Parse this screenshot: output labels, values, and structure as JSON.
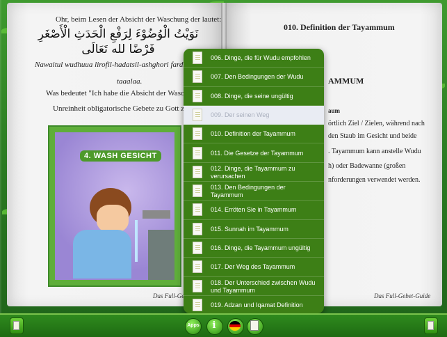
{
  "book": {
    "left": {
      "text1": "Ohr, beim Lesen der Absicht der Waschung der lautet:",
      "arabic": "نَوَيْتُ الْوُضُوْءَ لِرَفْعِ الْحَدَثِ الْأَصْغَرِ فَرْضًا لله تَعَالَى",
      "translit1": "Nawaitul wudhuua lirofil-hadatsil-ashghori fardhal li",
      "translit2": "taaalaa.",
      "text2": "Was bedeutet \"Ich habe die Absicht der Waschung",
      "text3": "Unreinheit obligatorische Gebete zu Gott zu bes",
      "illustration_title": "4. WASH GESICHT",
      "footer": "Das Full-Ge"
    },
    "right": {
      "title": "010. Definition der Tayammum",
      "heading": "AMMUM",
      "sub": "aum",
      "lines": [
        "örtlich Ziel / Zielen, während nach",
        "den Staub im Gesicht und beide",
        ".  Tayammum kann anstelle Wudu",
        "h)     oder     Badewanne     (großen",
        "nforderungen verwendet werden."
      ],
      "footer": "Das Full-Gebet-Guide"
    }
  },
  "menu": {
    "selected_index": 3,
    "items": [
      "006. Dinge, die für Wudu empfohlen",
      "007. Den Bedingungen der Wudu",
      "008. Dinge, die seine ungültig",
      "009. Der seinen Weg",
      "010. Definition der Tayammum",
      "011. Die Gesetze der Tayammum",
      "012. Dinge, die Tayammum zu verursachen",
      "013. Den Bedingungen der Tayammum",
      "014. Erröten Sie in Tayammum",
      "015. Sunnah im Tayammum",
      "016. Dinge, die Tayammum ungültig",
      "017. Der Weg des Tayammum",
      "018. Der Unterschied zwischen Wudu und Tayammum",
      "019. Adzan und Iqamat Definition"
    ]
  },
  "toolbar": {
    "app_label": "Apps",
    "info_glyph": "i",
    "icons": [
      "left-page-icon",
      "apps-icon",
      "info-icon",
      "german-flag-icon",
      "document-list-icon",
      "right-page-icon"
    ],
    "flag_colors": [
      "#000000",
      "#dd0000",
      "#ffce00"
    ]
  },
  "colors": {
    "accent_green": "#3d7f16",
    "page": "#eeeeee"
  }
}
